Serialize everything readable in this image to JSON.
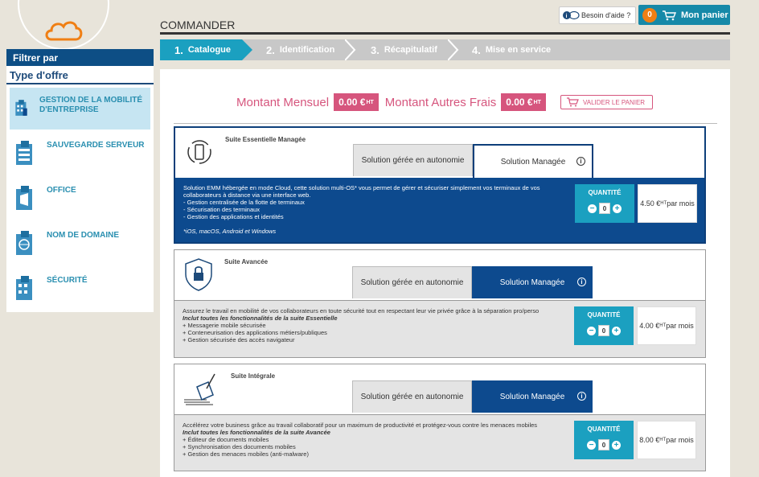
{
  "header": {
    "page_title": "COMMANDER",
    "help_label": "Besoin d'aide ?",
    "cart_label": "Mon panier",
    "cart_count": "0"
  },
  "steps": [
    {
      "num": "1.",
      "label": "Catalogue"
    },
    {
      "num": "2.",
      "label": "Identification"
    },
    {
      "num": "3.",
      "label": "Récapitulatif"
    },
    {
      "num": "4.",
      "label": "Mise en service"
    }
  ],
  "sidebar": {
    "filter_label": "Filtrer par",
    "type_label": "Type d'offre",
    "items": [
      {
        "label": "GESTION DE LA MOBILITÉ D'ENTREPRISE",
        "icon": "mobile-building-icon"
      },
      {
        "label": "SAUVEGARDE SERVEUR",
        "icon": "server-building-icon"
      },
      {
        "label": "OFFICE",
        "icon": "office-building-icon"
      },
      {
        "label": "NOM DE DOMAINE",
        "icon": "globe-building-icon"
      },
      {
        "label": "SÉCURITÉ",
        "icon": "security-building-icon"
      }
    ]
  },
  "totals": {
    "monthly_label": "Montant Mensuel",
    "monthly_value": "0.00 €",
    "other_label": "Montant Autres Frais",
    "other_value": "0.00 €",
    "ht": "HT",
    "validate_label": "VALIDER LE PANIER"
  },
  "colors": {
    "brand_blue": "#0d4a8e",
    "teal": "#1ba0c0",
    "pink": "#d6557d",
    "orange": "#f07f14"
  },
  "products": [
    {
      "name": "Suite Essentielle Managée",
      "tab_auto": "Solution gérée en autonomie",
      "tab_managed": "Solution Managée",
      "desc_lines": [
        "Solution EMM hébergée en mode Cloud, cette solution multi-OS* vous permet de gérer et sécuriser simplement vos terminaux de vos collaborateurs à distance via une interface web.",
        "- Gestion centralisée de la flotte de terminaux",
        "- Sécurisation des terminaux",
        "- Gestion des applications et identités"
      ],
      "footnote": "*iOS, macOS, Android et Windows",
      "qty_label": "QUANTITÉ",
      "qty": "0",
      "price": "4.50 €",
      "price_sup": "HT",
      "price_suffix": "par mois"
    },
    {
      "name": "Suite Avancée",
      "tab_auto": "Solution gérée en autonomie",
      "tab_managed": "Solution Managée",
      "desc_lines": [
        "Assurez le travail en mobilité de vos collaborateurs en toute sécurité tout en respectant leur vie privée grâce à la séparation pro/perso"
      ],
      "includes": "Inclut toutes les fonctionnalités de la suite Essentielle",
      "extra_lines": [
        "+ Messagerie mobile sécurisée",
        "+ Conteneurisation des applications métiers/publiques",
        "+ Gestion sécurisée des accès navigateur"
      ],
      "qty_label": "QUANTITÉ",
      "qty": "0",
      "price": "4.00 €",
      "price_sup": "HT",
      "price_suffix": "par mois"
    },
    {
      "name": "Suite Intégrale",
      "tab_auto": "Solution gérée en autonomie",
      "tab_managed": "Solution Managée",
      "desc_lines": [
        "Accélérez votre business grâce au travail collaboratif pour un maximum de productivité et protégez-vous contre les menaces mobiles"
      ],
      "includes": "Inclut toutes les fonctionnalités de la suite Avancée",
      "extra_lines": [
        "+ Éditeur de documents mobiles",
        "+ Synchronisation des documents mobiles",
        "+ Gestion des menaces mobiles (anti-malware)"
      ],
      "qty_label": "QUANTITÉ",
      "qty": "0",
      "price": "8.00 €",
      "price_sup": "HT",
      "price_suffix": "par mois"
    }
  ]
}
